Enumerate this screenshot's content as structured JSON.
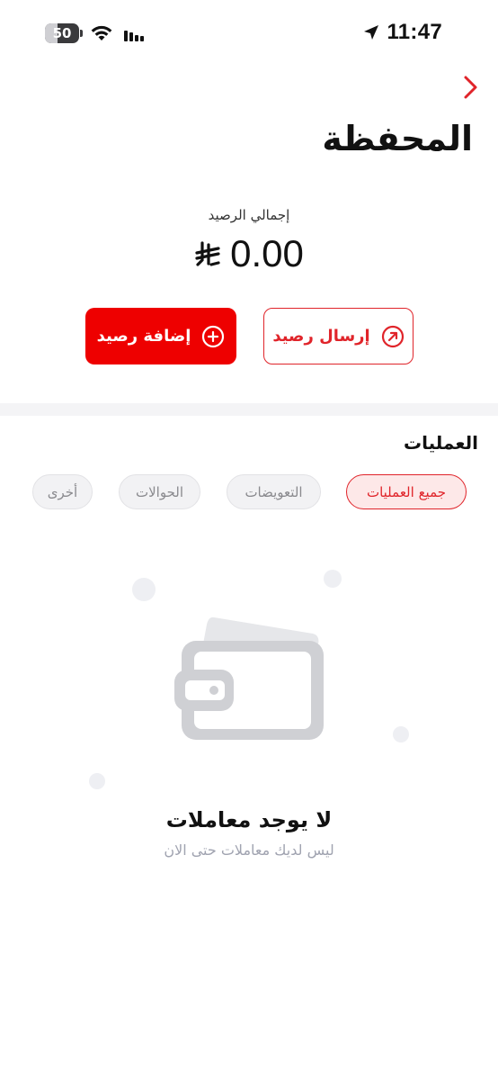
{
  "status_bar": {
    "battery": "50",
    "time": "11:47"
  },
  "header": {
    "title": "المحفظة"
  },
  "balance": {
    "label": "إجمالي الرصيد",
    "amount": "0.00"
  },
  "actions": {
    "send_label": "إرسال رصيد",
    "add_label": "إضافة رصيد"
  },
  "transactions": {
    "section_title": "العمليات",
    "filters": [
      {
        "label": "جميع العمليات",
        "active": true
      },
      {
        "label": "التعويضات",
        "active": false
      },
      {
        "label": "الحوالات",
        "active": false
      },
      {
        "label": "أخرى",
        "active": false
      }
    ],
    "empty_title": "لا يوجد معاملات",
    "empty_subtitle": "ليس لديك معاملات حتى الان"
  },
  "colors": {
    "accent": "#ee0000",
    "accent_border": "#e0242a",
    "chip_active_bg": "#fde8e8",
    "muted_text": "#a0a3b0"
  },
  "icons": {
    "back": "chevron-right-icon",
    "send": "arrow-up-right-circle-icon",
    "add": "plus-circle-icon",
    "currency": "saudi-riyal-icon",
    "empty": "wallet-icon"
  }
}
